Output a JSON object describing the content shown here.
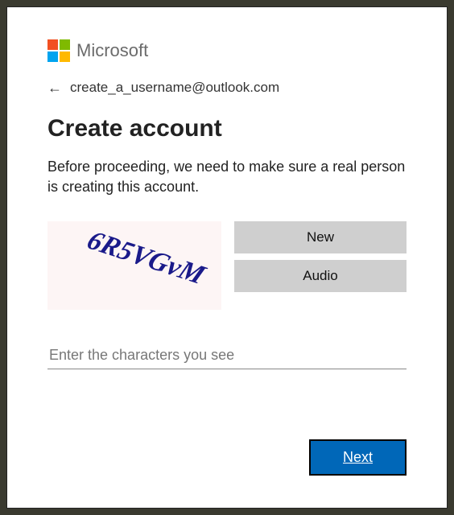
{
  "brand": {
    "name": "Microsoft"
  },
  "back": {
    "email": "create_a_username@outlook.com"
  },
  "heading": "Create account",
  "description": "Before proceeding, we need to make sure a real person is creating this account.",
  "captcha": {
    "text": "6R5VGVM",
    "new_label": "New",
    "audio_label": "Audio",
    "input_placeholder": "Enter the characters you see",
    "input_value": ""
  },
  "footer": {
    "next_label": "Next"
  },
  "colors": {
    "primary": "#0067b8"
  }
}
